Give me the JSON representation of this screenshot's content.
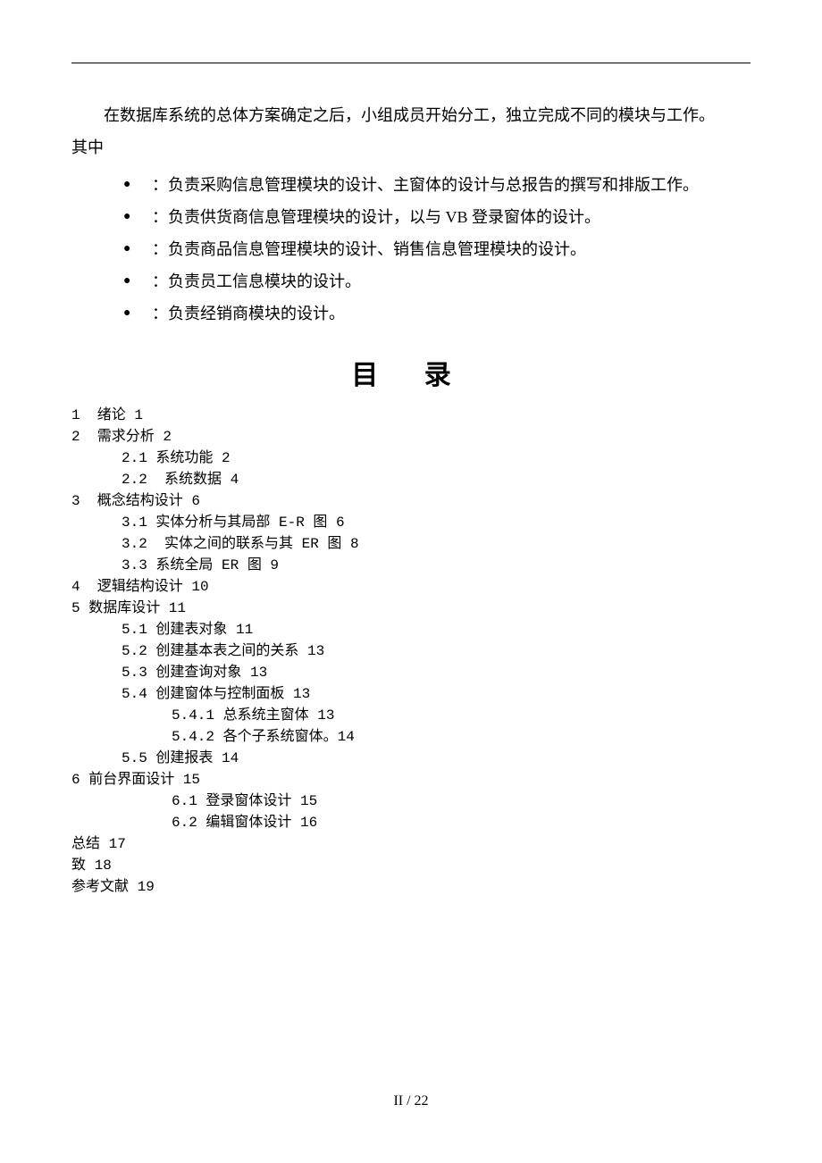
{
  "intro": {
    "line1": "在数据库系统的总体方案确定之后，小组成员开始分工，独立完成不同的模块与工作。",
    "line2": "其中"
  },
  "duties": [
    "：负责采购信息管理模块的设计、主窗体的设计与总报告的撰写和排版工作。",
    "：负责供货商信息管理模块的设计，以与 VB 登录窗体的设计。",
    "：负责商品信息管理模块的设计、销售信息管理模块的设计。",
    "：负责员工信息模块的设计。",
    "：负责经销商模块的设计。"
  ],
  "toc_title": "目 录",
  "toc": [
    {
      "level": 1,
      "text": "1  绪论 1"
    },
    {
      "level": 1,
      "text": "2  需求分析 2"
    },
    {
      "level": 2,
      "text": "2.1 系统功能 2"
    },
    {
      "level": 2,
      "text": "2.2  系统数据 4"
    },
    {
      "level": 1,
      "text": "3  概念结构设计 6"
    },
    {
      "level": 2,
      "text": "3.1 实体分析与其局部 E-R 图 6"
    },
    {
      "level": 2,
      "text": "3.2  实体之间的联系与其 ER 图 8"
    },
    {
      "level": 2,
      "text": "3.3 系统全局 ER 图 9"
    },
    {
      "level": 1,
      "text": "4  逻辑结构设计 10"
    },
    {
      "level": 1,
      "text": "5 数据库设计 11"
    },
    {
      "level": 2,
      "text": "5.1 创建表对象 11"
    },
    {
      "level": 2,
      "text": "5.2 创建基本表之间的关系 13"
    },
    {
      "level": 2,
      "text": "5.3 创建查询对象 13"
    },
    {
      "level": 2,
      "text": "5.4 创建窗体与控制面板 13"
    },
    {
      "level": 3,
      "text": "5.4.1 总系统主窗体 13"
    },
    {
      "level": 3,
      "text": "5.4.2 各个子系统窗体。14"
    },
    {
      "level": 2,
      "text": "5.5 创建报表 14"
    },
    {
      "level": 1,
      "text": "6 前台界面设计 15"
    },
    {
      "level": 3,
      "text": "6.1 登录窗体设计 15"
    },
    {
      "level": 3,
      "text": "6.2 编辑窗体设计 16"
    },
    {
      "level": 1,
      "text": "总结 17"
    },
    {
      "level": 1,
      "text": "致 18"
    },
    {
      "level": 1,
      "text": "参考文献 19"
    }
  ],
  "footer": "II / 22"
}
